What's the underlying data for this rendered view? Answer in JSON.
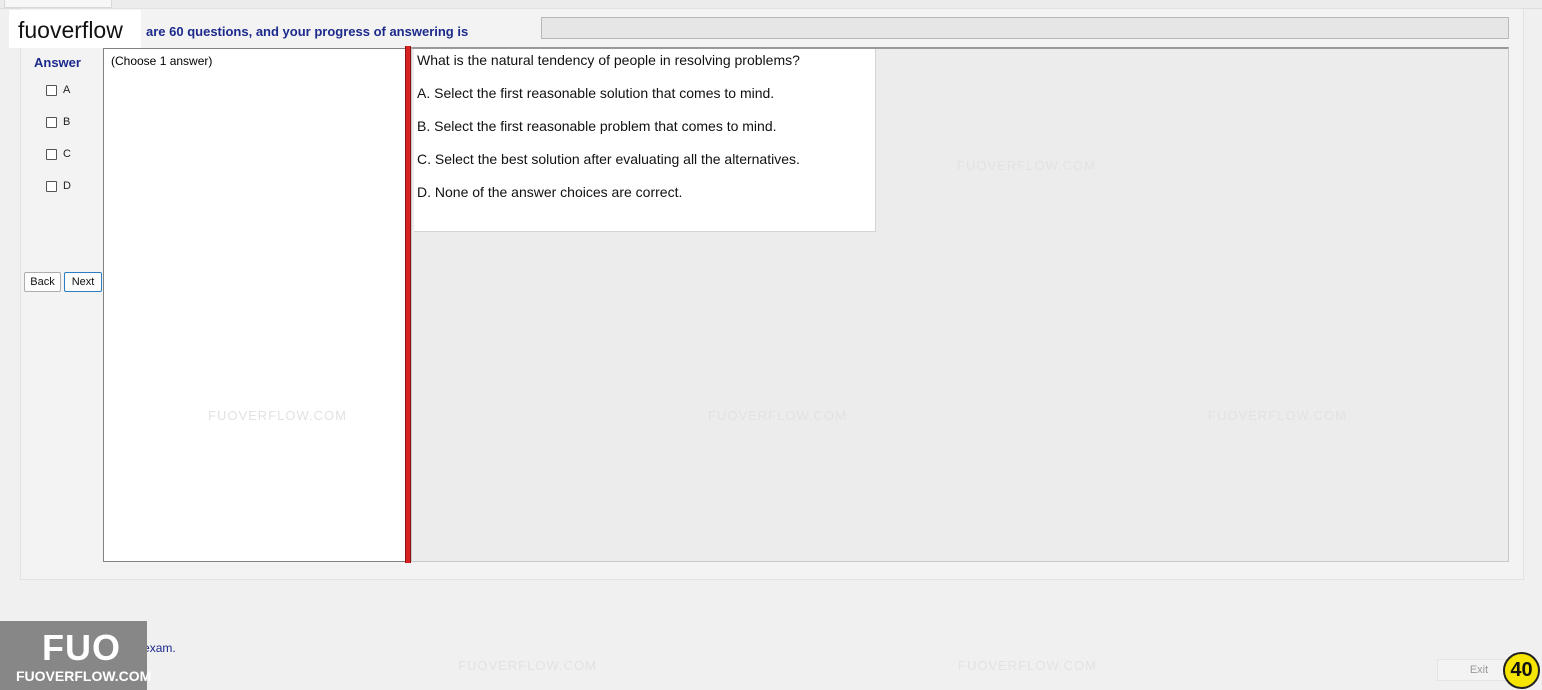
{
  "header": {
    "intro_text": "are 60 questions, and your progress of answering is",
    "progress_fraction": 0.0
  },
  "logo": {
    "text": "fuoverflow"
  },
  "answer": {
    "title": "Answer",
    "options": [
      "A",
      "B",
      "C",
      "D"
    ],
    "back_label": "Back",
    "next_label": "Next"
  },
  "choose_hint": "(Choose 1 answer)",
  "question": {
    "text": "What is the natural tendency of people in resolving problems?",
    "options": [
      "A.  Select the first reasonable solution that comes to mind.",
      "B.  Select the first reasonable problem that comes to mind.",
      "C.  Select the best solution after evaluating all the alternatives.",
      "D.  None of the answer choices are correct."
    ]
  },
  "watermark": {
    "text": "FUOVERFLOW.COM"
  },
  "footer": {
    "finish_label": "I want to finish the exam.",
    "exit_label": "Exit",
    "timer_value": "40",
    "brand_big": "FUO",
    "brand_small": "FUOVERFLOW.COM"
  },
  "colors": {
    "accent_text": "#1c2a8c",
    "red_divider": "#d62222",
    "timer_bg": "#f6e500"
  }
}
